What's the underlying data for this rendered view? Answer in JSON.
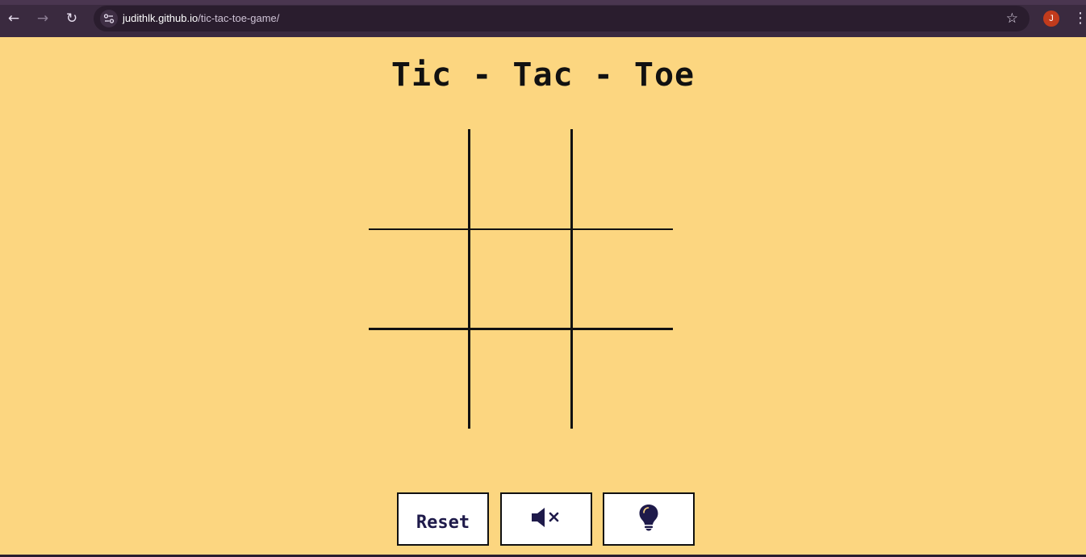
{
  "browser": {
    "url_host": "judithlk.github.io",
    "url_path": "/tic-tac-toe-game/",
    "profile_initial": "J",
    "icons": [
      "back-arrow-icon",
      "forward-arrow-icon",
      "reload-icon",
      "site-info-icon",
      "bookmark-star-icon",
      "more-menu-icon"
    ]
  },
  "page": {
    "title": "Tic - Tac - Toe"
  },
  "board": {
    "cells": [
      "",
      "",
      "",
      "",
      "",
      "",
      "",
      "",
      ""
    ]
  },
  "controls": {
    "reset_label": "Reset",
    "sound_icon": "speaker-muted-icon",
    "hint_icon": "lightbulb-icon"
  },
  "colors": {
    "background": "#fcd680",
    "browser_chrome": "#3a2a3f",
    "button_text": "#1e1a4a",
    "profile_avatar": "#c23b1c"
  }
}
